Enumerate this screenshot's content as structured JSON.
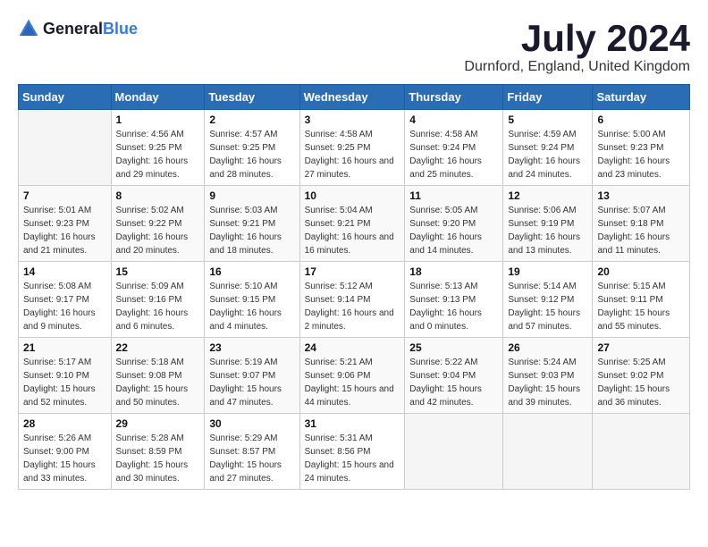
{
  "logo": {
    "text_general": "General",
    "text_blue": "Blue"
  },
  "title": {
    "month_year": "July 2024",
    "location": "Durnford, England, United Kingdom"
  },
  "days_of_week": [
    "Sunday",
    "Monday",
    "Tuesday",
    "Wednesday",
    "Thursday",
    "Friday",
    "Saturday"
  ],
  "weeks": [
    [
      {
        "day": "",
        "sunrise": "",
        "sunset": "",
        "daylight": ""
      },
      {
        "day": "1",
        "sunrise": "Sunrise: 4:56 AM",
        "sunset": "Sunset: 9:25 PM",
        "daylight": "Daylight: 16 hours and 29 minutes."
      },
      {
        "day": "2",
        "sunrise": "Sunrise: 4:57 AM",
        "sunset": "Sunset: 9:25 PM",
        "daylight": "Daylight: 16 hours and 28 minutes."
      },
      {
        "day": "3",
        "sunrise": "Sunrise: 4:58 AM",
        "sunset": "Sunset: 9:25 PM",
        "daylight": "Daylight: 16 hours and 27 minutes."
      },
      {
        "day": "4",
        "sunrise": "Sunrise: 4:58 AM",
        "sunset": "Sunset: 9:24 PM",
        "daylight": "Daylight: 16 hours and 25 minutes."
      },
      {
        "day": "5",
        "sunrise": "Sunrise: 4:59 AM",
        "sunset": "Sunset: 9:24 PM",
        "daylight": "Daylight: 16 hours and 24 minutes."
      },
      {
        "day": "6",
        "sunrise": "Sunrise: 5:00 AM",
        "sunset": "Sunset: 9:23 PM",
        "daylight": "Daylight: 16 hours and 23 minutes."
      }
    ],
    [
      {
        "day": "7",
        "sunrise": "Sunrise: 5:01 AM",
        "sunset": "Sunset: 9:23 PM",
        "daylight": "Daylight: 16 hours and 21 minutes."
      },
      {
        "day": "8",
        "sunrise": "Sunrise: 5:02 AM",
        "sunset": "Sunset: 9:22 PM",
        "daylight": "Daylight: 16 hours and 20 minutes."
      },
      {
        "day": "9",
        "sunrise": "Sunrise: 5:03 AM",
        "sunset": "Sunset: 9:21 PM",
        "daylight": "Daylight: 16 hours and 18 minutes."
      },
      {
        "day": "10",
        "sunrise": "Sunrise: 5:04 AM",
        "sunset": "Sunset: 9:21 PM",
        "daylight": "Daylight: 16 hours and 16 minutes."
      },
      {
        "day": "11",
        "sunrise": "Sunrise: 5:05 AM",
        "sunset": "Sunset: 9:20 PM",
        "daylight": "Daylight: 16 hours and 14 minutes."
      },
      {
        "day": "12",
        "sunrise": "Sunrise: 5:06 AM",
        "sunset": "Sunset: 9:19 PM",
        "daylight": "Daylight: 16 hours and 13 minutes."
      },
      {
        "day": "13",
        "sunrise": "Sunrise: 5:07 AM",
        "sunset": "Sunset: 9:18 PM",
        "daylight": "Daylight: 16 hours and 11 minutes."
      }
    ],
    [
      {
        "day": "14",
        "sunrise": "Sunrise: 5:08 AM",
        "sunset": "Sunset: 9:17 PM",
        "daylight": "Daylight: 16 hours and 9 minutes."
      },
      {
        "day": "15",
        "sunrise": "Sunrise: 5:09 AM",
        "sunset": "Sunset: 9:16 PM",
        "daylight": "Daylight: 16 hours and 6 minutes."
      },
      {
        "day": "16",
        "sunrise": "Sunrise: 5:10 AM",
        "sunset": "Sunset: 9:15 PM",
        "daylight": "Daylight: 16 hours and 4 minutes."
      },
      {
        "day": "17",
        "sunrise": "Sunrise: 5:12 AM",
        "sunset": "Sunset: 9:14 PM",
        "daylight": "Daylight: 16 hours and 2 minutes."
      },
      {
        "day": "18",
        "sunrise": "Sunrise: 5:13 AM",
        "sunset": "Sunset: 9:13 PM",
        "daylight": "Daylight: 16 hours and 0 minutes."
      },
      {
        "day": "19",
        "sunrise": "Sunrise: 5:14 AM",
        "sunset": "Sunset: 9:12 PM",
        "daylight": "Daylight: 15 hours and 57 minutes."
      },
      {
        "day": "20",
        "sunrise": "Sunrise: 5:15 AM",
        "sunset": "Sunset: 9:11 PM",
        "daylight": "Daylight: 15 hours and 55 minutes."
      }
    ],
    [
      {
        "day": "21",
        "sunrise": "Sunrise: 5:17 AM",
        "sunset": "Sunset: 9:10 PM",
        "daylight": "Daylight: 15 hours and 52 minutes."
      },
      {
        "day": "22",
        "sunrise": "Sunrise: 5:18 AM",
        "sunset": "Sunset: 9:08 PM",
        "daylight": "Daylight: 15 hours and 50 minutes."
      },
      {
        "day": "23",
        "sunrise": "Sunrise: 5:19 AM",
        "sunset": "Sunset: 9:07 PM",
        "daylight": "Daylight: 15 hours and 47 minutes."
      },
      {
        "day": "24",
        "sunrise": "Sunrise: 5:21 AM",
        "sunset": "Sunset: 9:06 PM",
        "daylight": "Daylight: 15 hours and 44 minutes."
      },
      {
        "day": "25",
        "sunrise": "Sunrise: 5:22 AM",
        "sunset": "Sunset: 9:04 PM",
        "daylight": "Daylight: 15 hours and 42 minutes."
      },
      {
        "day": "26",
        "sunrise": "Sunrise: 5:24 AM",
        "sunset": "Sunset: 9:03 PM",
        "daylight": "Daylight: 15 hours and 39 minutes."
      },
      {
        "day": "27",
        "sunrise": "Sunrise: 5:25 AM",
        "sunset": "Sunset: 9:02 PM",
        "daylight": "Daylight: 15 hours and 36 minutes."
      }
    ],
    [
      {
        "day": "28",
        "sunrise": "Sunrise: 5:26 AM",
        "sunset": "Sunset: 9:00 PM",
        "daylight": "Daylight: 15 hours and 33 minutes."
      },
      {
        "day": "29",
        "sunrise": "Sunrise: 5:28 AM",
        "sunset": "Sunset: 8:59 PM",
        "daylight": "Daylight: 15 hours and 30 minutes."
      },
      {
        "day": "30",
        "sunrise": "Sunrise: 5:29 AM",
        "sunset": "Sunset: 8:57 PM",
        "daylight": "Daylight: 15 hours and 27 minutes."
      },
      {
        "day": "31",
        "sunrise": "Sunrise: 5:31 AM",
        "sunset": "Sunset: 8:56 PM",
        "daylight": "Daylight: 15 hours and 24 minutes."
      },
      {
        "day": "",
        "sunrise": "",
        "sunset": "",
        "daylight": ""
      },
      {
        "day": "",
        "sunrise": "",
        "sunset": "",
        "daylight": ""
      },
      {
        "day": "",
        "sunrise": "",
        "sunset": "",
        "daylight": ""
      }
    ]
  ]
}
